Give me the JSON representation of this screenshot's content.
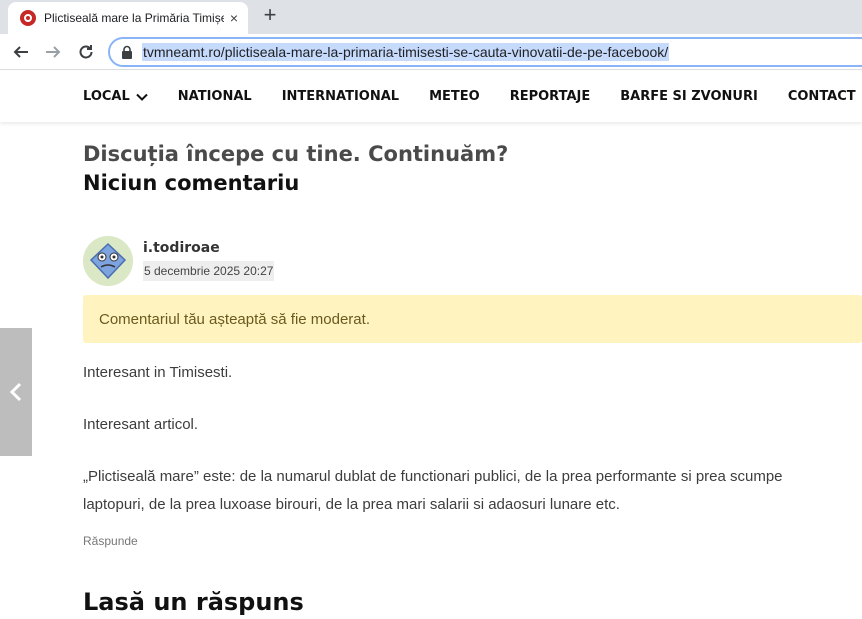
{
  "browser": {
    "tab_title": "Plictiseală mare la Primăria Timișești se caută vinovații de pe Facebook",
    "tab_close": "×",
    "new_tab": "+",
    "url": "tvmneamt.ro/plictiseala-mare-la-primaria-timisesti-se-cauta-vinovatii-de-pe-facebook/"
  },
  "nav": {
    "items": [
      {
        "label": "LOCAL"
      },
      {
        "label": "NATIONAL"
      },
      {
        "label": "INTERNATIONAL"
      },
      {
        "label": "METEO"
      },
      {
        "label": "REPORTAJE"
      },
      {
        "label": "BARFE SI ZVONURI"
      },
      {
        "label": "CONTACT"
      }
    ]
  },
  "comments": {
    "heading": "Discuția începe cu tine. Continuăm?",
    "count_label": "Niciun comentariu",
    "author": "i.todiroae",
    "date": "5 decembrie 2025 20:27",
    "moderation_notice": "Comentariul tău așteaptă să fie moderat.",
    "paragraphs": [
      "Interesant in Timisesti.",
      "Interesant articol.",
      "„Plictiseală mare” este: de la numarul dublat de functionari publici, de la prea performante si prea scumpe laptopuri, de la prea luxoase birouri, de la prea mari salarii si adaosuri lunare etc."
    ],
    "reply_label": "Răspunde",
    "leave_reply_heading": "Lasă un răspuns"
  },
  "colors": {
    "omnibox_border": "#8ab4f8",
    "url_highlight": "#c6dafc",
    "moderation_bg": "#fff4bf",
    "favicon": "#c62828"
  },
  "icons": [
    "favicon-icon",
    "close-icon",
    "plus-icon",
    "back-arrow-icon",
    "forward-arrow-icon",
    "reload-icon",
    "lock-icon",
    "chevron-down-icon",
    "chevron-left-icon"
  ]
}
